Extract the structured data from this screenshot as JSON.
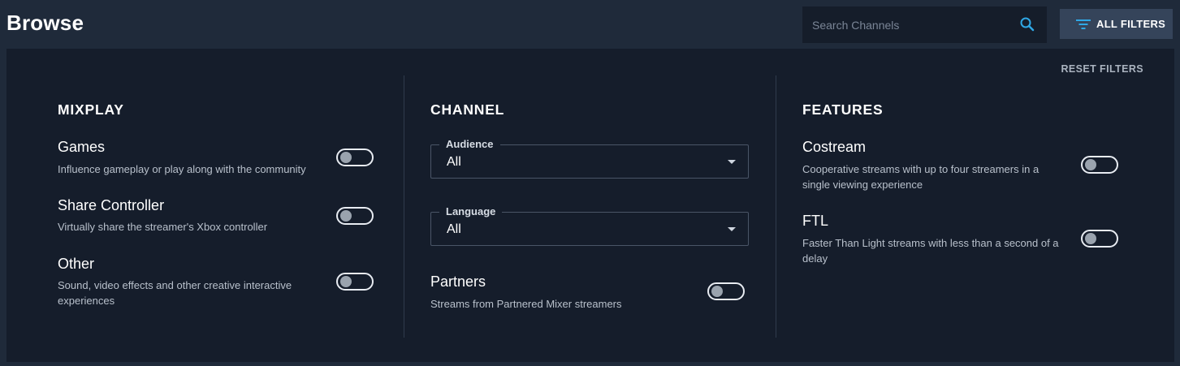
{
  "header": {
    "title": "Browse",
    "search_placeholder": "Search Channels",
    "search_icon": "search-icon",
    "filters_label": "ALL FILTERS",
    "filters_icon": "filter-icon",
    "accent_color": "#2fa8e6"
  },
  "panel": {
    "reset_label": "RESET FILTERS",
    "mixplay": {
      "title": "MIXPLAY",
      "options": [
        {
          "label": "Games",
          "description": "Influence gameplay or play along with the community",
          "enabled": false
        },
        {
          "label": "Share Controller",
          "description": "Virtually share the streamer's Xbox controller",
          "enabled": false
        },
        {
          "label": "Other",
          "description": "Sound, video effects and other creative interactive experiences",
          "enabled": false
        }
      ]
    },
    "channel": {
      "title": "CHANNEL",
      "audience": {
        "label": "Audience",
        "value": "All"
      },
      "language": {
        "label": "Language",
        "value": "All"
      },
      "partners": {
        "label": "Partners",
        "description": "Streams from Partnered Mixer streamers",
        "enabled": false
      }
    },
    "features": {
      "title": "FEATURES",
      "options": [
        {
          "label": "Costream",
          "description": "Cooperative streams with up to four streamers in a single viewing experience",
          "enabled": false
        },
        {
          "label": "FTL",
          "description": "Faster Than Light streams with less than a second of a delay",
          "enabled": false
        }
      ]
    }
  }
}
